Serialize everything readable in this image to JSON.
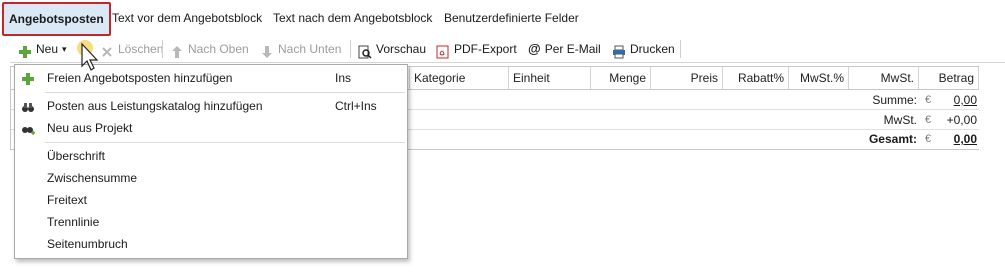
{
  "tabs": [
    "Angebotsposten",
    "Text vor dem Angebotsblock",
    "Text nach dem Angebotsblock",
    "Benutzerdefinierte Felder"
  ],
  "toolbar": {
    "new_label": "Neu",
    "delete_label": "Löschen",
    "up_label": "Nach Oben",
    "down_label": "Nach Unten",
    "preview_label": "Vorschau",
    "pdf_label": "PDF-Export",
    "email_label": "Per E-Mail",
    "print_label": "Drucken"
  },
  "grid": {
    "columns": [
      "Kategorie",
      "Einheit",
      "Menge",
      "Preis",
      "Rabatt%",
      "MwSt.%",
      "MwSt.",
      "Betrag"
    ]
  },
  "summary": {
    "sum_label": "Summe:",
    "sum_currency": "€",
    "sum_value": "0,00",
    "vat_label": "MwSt.",
    "vat_currency": "€",
    "vat_value": "+0,00",
    "total_label": "Gesamt:",
    "total_currency": "€",
    "total_value": "0,00"
  },
  "menu": {
    "item_free": "Freien Angebotsposten hinzufügen",
    "item_free_shortcut": "Ins",
    "item_catalog": "Posten aus Leistungskatalog hinzufügen",
    "item_catalog_shortcut": "Ctrl+Ins",
    "item_project": "Neu aus Projekt",
    "item_heading": "Überschrift",
    "item_subtotal": "Zwischensumme",
    "item_freetext": "Freitext",
    "item_divider": "Trennlinie",
    "item_pagebreak": "Seitenumbruch"
  },
  "colors": {
    "active_tab_border": "#c0282d",
    "add_icon": "#5aa63a",
    "pdf_icon": "#c0282d"
  }
}
